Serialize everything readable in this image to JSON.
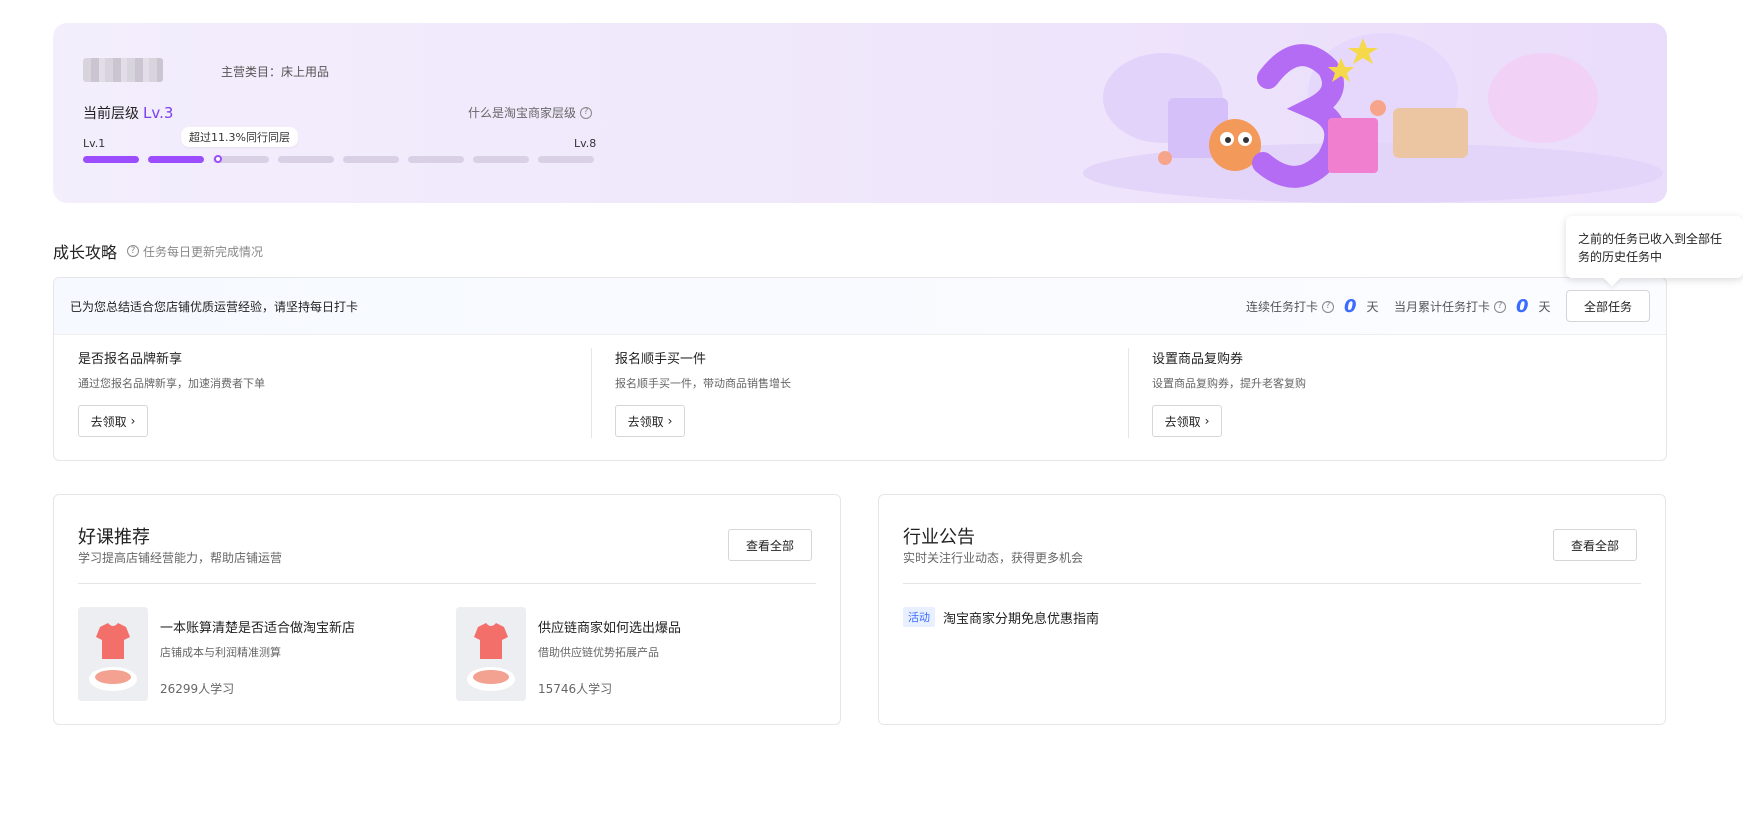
{
  "banner": {
    "category": "主营类目：床上用品",
    "level_label": "当前层级",
    "level_value": "Lv.3",
    "what_level": "什么是淘宝商家层级",
    "tip": "超过11.3%同行同层",
    "lv_start": "Lv.1",
    "lv_end": "Lv.8",
    "progress_completed_segments": 2,
    "progress_total_segments": 8
  },
  "growth": {
    "title": "成长攻略",
    "subtitle": "任务每日更新完成情况",
    "head_text": "已为您总结适合您店铺优质运营经验，请坚持每日打卡",
    "streak_label": "连续任务打卡",
    "streak_value": "0",
    "streak_unit": "天",
    "month_label": "当月累计任务打卡",
    "month_value": "0",
    "month_unit": "天",
    "all_tasks": "全部任务",
    "tooltip": "之前的任务已收入到全部任务的历史任务中",
    "tasks": [
      {
        "title": "是否报名品牌新享",
        "desc": "通过您报名品牌新享，加速消费者下单",
        "button": "去领取"
      },
      {
        "title": "报名顺手买一件",
        "desc": "报名顺手买一件，带动商品销售增长",
        "button": "去领取"
      },
      {
        "title": "设置商品复购券",
        "desc": "设置商品复购券，提升老客复购",
        "button": "去领取"
      }
    ]
  },
  "courses": {
    "title": "好课推荐",
    "subtitle": "学习提高店铺经营能力，帮助店铺运营",
    "view_all": "查看全部",
    "items": [
      {
        "title": "一本账算清楚是否适合做淘宝新店",
        "desc": "店铺成本与利润精准测算",
        "count": "26299人学习"
      },
      {
        "title": "供应链商家如何选出爆品",
        "desc": "借助供应链优势拓展产品",
        "count": "15746人学习"
      }
    ]
  },
  "notices": {
    "title": "行业公告",
    "subtitle": "实时关注行业动态，获得更多机会",
    "view_all": "查看全部",
    "items": [
      {
        "tag": "活动",
        "text": "淘宝商家分期免息优惠指南"
      }
    ]
  },
  "colors": {
    "accent": "#9b4dff",
    "level": "#7a3ff0",
    "number_blue": "#3b6cff"
  }
}
